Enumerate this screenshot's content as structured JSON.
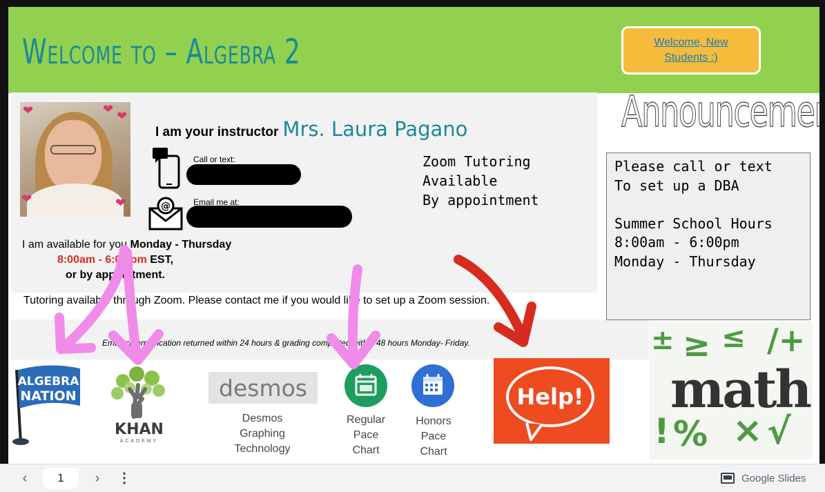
{
  "slide": {
    "title": "Welcome to – Algebra 2",
    "welcome_link": "Welcome, New Students :)",
    "instructor_prefix": "I am your instructor",
    "instructor_name": "Mrs. Laura Pagano",
    "call_label": "Call or text:",
    "email_label": "Email me at:",
    "zoom_note": "Zoom Tutoring\nAvailable\nBy appointment",
    "availability": {
      "line1_prefix": "I am available for you ",
      "line1_days": "Monday - Thursday",
      "hours_red": "8:00am - 6:00 pm",
      "hours_suffix": " EST,",
      "line3": "or by appointment."
    },
    "tutoring_line": "Tutoring available through Zoom. Please contact me if you would like to set up a Zoom session.",
    "communication_line": "Email communication returned within 24 hours & grading completed within 48 hours Monday- Friday.",
    "announcements_title": "Announcements",
    "announcements_text": "Please call or text\nTo set up a DBA\n\nSummer School Hours\n8:00am - 6:00pm\nMonday - Thursday",
    "links": {
      "algebra_nation_top": "ALGEBRA",
      "algebra_nation_bottom": "NATION",
      "khan_name": "KHAN",
      "khan_sub": "ACADEMY",
      "desmos_word": "desmos",
      "desmos_label": "Desmos\nGraphing\nTechnology",
      "regular_label": "Regular\nPace\nChart",
      "honors_label": "Honors\nPace\nChart",
      "help_word": "Help!",
      "math_word": "math"
    },
    "colors": {
      "header_green": "#92d050",
      "title_teal": "#1a8a97",
      "button_gold": "#f4bc3a",
      "arrow_pink": "#f08bea",
      "arrow_red": "#d62b1e",
      "help_orange": "#ee4b21"
    }
  },
  "footer": {
    "page_number": "1",
    "prev_icon": "chevron-left-icon",
    "next_icon": "chevron-right-icon",
    "menu_icon": "more-vertical-icon",
    "brand_label": "Google Slides"
  }
}
